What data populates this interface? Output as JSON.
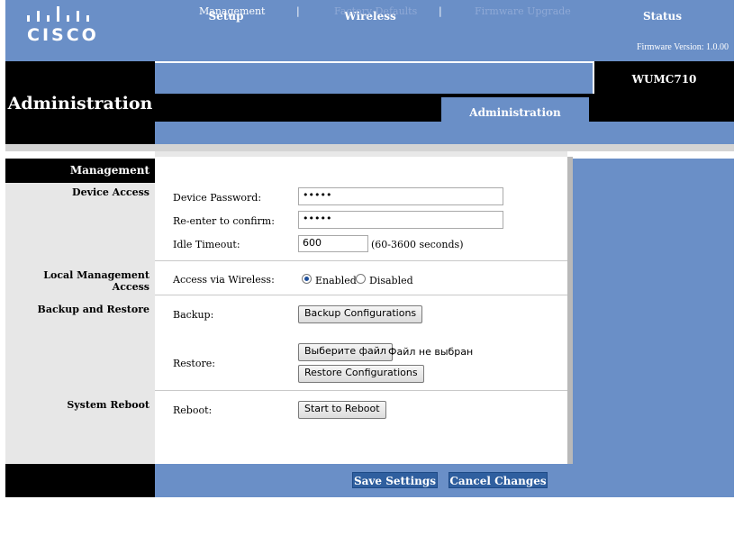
{
  "header": {
    "logo_text": "CISCO",
    "firmware": "Firmware Version:  1.0.00"
  },
  "left_title": "Administration",
  "model": "WUMC710",
  "tabs": [
    "Setup",
    "Wireless",
    "Administration",
    "Status"
  ],
  "subtabs": [
    "Management",
    "Factory Defaults",
    "Firmware Upgrade"
  ],
  "subtab_separator": "|",
  "nav": {
    "header": "Management",
    "sections": [
      "Device Access",
      "Local Management Access",
      "Backup and Restore",
      "System Reboot"
    ]
  },
  "form": {
    "device_password_label": "Device Password:",
    "device_password_value": "•••••",
    "reenter_label": "Re-enter to confirm:",
    "reenter_value": "•••••",
    "idle_label": "Idle Timeout:",
    "idle_value": "600",
    "idle_hint": "(60-3600 seconds)",
    "access_label": "Access via Wireless:",
    "enabled_label": "Enabled",
    "disabled_label": "Disabled",
    "backup_label": "Backup:",
    "backup_button": "Backup Configurations",
    "restore_label": "Restore:",
    "choose_file_button": "Выберите файл",
    "no_file_text": "Файл не выбран",
    "restore_button": "Restore Configurations",
    "reboot_label": "Reboot:",
    "reboot_button": "Start to Reboot"
  },
  "footer": {
    "save": "Save Settings",
    "cancel": "Cancel Changes"
  },
  "colors": {
    "brand_blue": "#6a8fc7",
    "black": "#000000"
  }
}
